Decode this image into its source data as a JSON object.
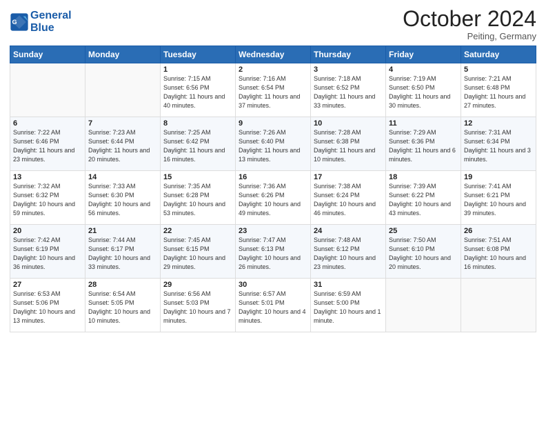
{
  "header": {
    "logo_line1": "General",
    "logo_line2": "Blue",
    "month": "October 2024",
    "location": "Peiting, Germany"
  },
  "weekdays": [
    "Sunday",
    "Monday",
    "Tuesday",
    "Wednesday",
    "Thursday",
    "Friday",
    "Saturday"
  ],
  "weeks": [
    [
      {
        "day": "",
        "sunrise": "",
        "sunset": "",
        "daylight": ""
      },
      {
        "day": "",
        "sunrise": "",
        "sunset": "",
        "daylight": ""
      },
      {
        "day": "1",
        "sunrise": "Sunrise: 7:15 AM",
        "sunset": "Sunset: 6:56 PM",
        "daylight": "Daylight: 11 hours and 40 minutes."
      },
      {
        "day": "2",
        "sunrise": "Sunrise: 7:16 AM",
        "sunset": "Sunset: 6:54 PM",
        "daylight": "Daylight: 11 hours and 37 minutes."
      },
      {
        "day": "3",
        "sunrise": "Sunrise: 7:18 AM",
        "sunset": "Sunset: 6:52 PM",
        "daylight": "Daylight: 11 hours and 33 minutes."
      },
      {
        "day": "4",
        "sunrise": "Sunrise: 7:19 AM",
        "sunset": "Sunset: 6:50 PM",
        "daylight": "Daylight: 11 hours and 30 minutes."
      },
      {
        "day": "5",
        "sunrise": "Sunrise: 7:21 AM",
        "sunset": "Sunset: 6:48 PM",
        "daylight": "Daylight: 11 hours and 27 minutes."
      }
    ],
    [
      {
        "day": "6",
        "sunrise": "Sunrise: 7:22 AM",
        "sunset": "Sunset: 6:46 PM",
        "daylight": "Daylight: 11 hours and 23 minutes."
      },
      {
        "day": "7",
        "sunrise": "Sunrise: 7:23 AM",
        "sunset": "Sunset: 6:44 PM",
        "daylight": "Daylight: 11 hours and 20 minutes."
      },
      {
        "day": "8",
        "sunrise": "Sunrise: 7:25 AM",
        "sunset": "Sunset: 6:42 PM",
        "daylight": "Daylight: 11 hours and 16 minutes."
      },
      {
        "day": "9",
        "sunrise": "Sunrise: 7:26 AM",
        "sunset": "Sunset: 6:40 PM",
        "daylight": "Daylight: 11 hours and 13 minutes."
      },
      {
        "day": "10",
        "sunrise": "Sunrise: 7:28 AM",
        "sunset": "Sunset: 6:38 PM",
        "daylight": "Daylight: 11 hours and 10 minutes."
      },
      {
        "day": "11",
        "sunrise": "Sunrise: 7:29 AM",
        "sunset": "Sunset: 6:36 PM",
        "daylight": "Daylight: 11 hours and 6 minutes."
      },
      {
        "day": "12",
        "sunrise": "Sunrise: 7:31 AM",
        "sunset": "Sunset: 6:34 PM",
        "daylight": "Daylight: 11 hours and 3 minutes."
      }
    ],
    [
      {
        "day": "13",
        "sunrise": "Sunrise: 7:32 AM",
        "sunset": "Sunset: 6:32 PM",
        "daylight": "Daylight: 10 hours and 59 minutes."
      },
      {
        "day": "14",
        "sunrise": "Sunrise: 7:33 AM",
        "sunset": "Sunset: 6:30 PM",
        "daylight": "Daylight: 10 hours and 56 minutes."
      },
      {
        "day": "15",
        "sunrise": "Sunrise: 7:35 AM",
        "sunset": "Sunset: 6:28 PM",
        "daylight": "Daylight: 10 hours and 53 minutes."
      },
      {
        "day": "16",
        "sunrise": "Sunrise: 7:36 AM",
        "sunset": "Sunset: 6:26 PM",
        "daylight": "Daylight: 10 hours and 49 minutes."
      },
      {
        "day": "17",
        "sunrise": "Sunrise: 7:38 AM",
        "sunset": "Sunset: 6:24 PM",
        "daylight": "Daylight: 10 hours and 46 minutes."
      },
      {
        "day": "18",
        "sunrise": "Sunrise: 7:39 AM",
        "sunset": "Sunset: 6:22 PM",
        "daylight": "Daylight: 10 hours and 43 minutes."
      },
      {
        "day": "19",
        "sunrise": "Sunrise: 7:41 AM",
        "sunset": "Sunset: 6:21 PM",
        "daylight": "Daylight: 10 hours and 39 minutes."
      }
    ],
    [
      {
        "day": "20",
        "sunrise": "Sunrise: 7:42 AM",
        "sunset": "Sunset: 6:19 PM",
        "daylight": "Daylight: 10 hours and 36 minutes."
      },
      {
        "day": "21",
        "sunrise": "Sunrise: 7:44 AM",
        "sunset": "Sunset: 6:17 PM",
        "daylight": "Daylight: 10 hours and 33 minutes."
      },
      {
        "day": "22",
        "sunrise": "Sunrise: 7:45 AM",
        "sunset": "Sunset: 6:15 PM",
        "daylight": "Daylight: 10 hours and 29 minutes."
      },
      {
        "day": "23",
        "sunrise": "Sunrise: 7:47 AM",
        "sunset": "Sunset: 6:13 PM",
        "daylight": "Daylight: 10 hours and 26 minutes."
      },
      {
        "day": "24",
        "sunrise": "Sunrise: 7:48 AM",
        "sunset": "Sunset: 6:12 PM",
        "daylight": "Daylight: 10 hours and 23 minutes."
      },
      {
        "day": "25",
        "sunrise": "Sunrise: 7:50 AM",
        "sunset": "Sunset: 6:10 PM",
        "daylight": "Daylight: 10 hours and 20 minutes."
      },
      {
        "day": "26",
        "sunrise": "Sunrise: 7:51 AM",
        "sunset": "Sunset: 6:08 PM",
        "daylight": "Daylight: 10 hours and 16 minutes."
      }
    ],
    [
      {
        "day": "27",
        "sunrise": "Sunrise: 6:53 AM",
        "sunset": "Sunset: 5:06 PM",
        "daylight": "Daylight: 10 hours and 13 minutes."
      },
      {
        "day": "28",
        "sunrise": "Sunrise: 6:54 AM",
        "sunset": "Sunset: 5:05 PM",
        "daylight": "Daylight: 10 hours and 10 minutes."
      },
      {
        "day": "29",
        "sunrise": "Sunrise: 6:56 AM",
        "sunset": "Sunset: 5:03 PM",
        "daylight": "Daylight: 10 hours and 7 minutes."
      },
      {
        "day": "30",
        "sunrise": "Sunrise: 6:57 AM",
        "sunset": "Sunset: 5:01 PM",
        "daylight": "Daylight: 10 hours and 4 minutes."
      },
      {
        "day": "31",
        "sunrise": "Sunrise: 6:59 AM",
        "sunset": "Sunset: 5:00 PM",
        "daylight": "Daylight: 10 hours and 1 minute."
      },
      {
        "day": "",
        "sunrise": "",
        "sunset": "",
        "daylight": ""
      },
      {
        "day": "",
        "sunrise": "",
        "sunset": "",
        "daylight": ""
      }
    ]
  ]
}
